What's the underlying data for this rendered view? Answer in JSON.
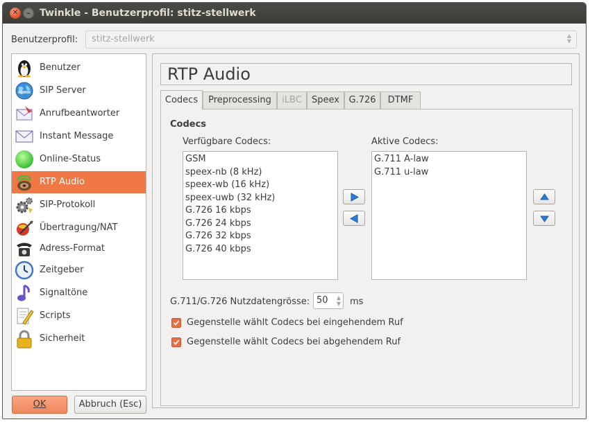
{
  "window": {
    "title": "Twinkle - Benutzerprofil: stitz-stellwerk"
  },
  "profile": {
    "label": "Benutzerprofil:",
    "value": "stitz-stellwerk"
  },
  "sidebar": {
    "items": [
      {
        "label": "Benutzer",
        "icon": "penguin-user-icon"
      },
      {
        "label": "SIP Server",
        "icon": "globe-server-icon"
      },
      {
        "label": "Anrufbeantworter",
        "icon": "voicemail-envelope-icon"
      },
      {
        "label": "Instant Message",
        "icon": "envelope-icon"
      },
      {
        "label": "Online-Status",
        "icon": "green-status-icon"
      },
      {
        "label": "RTP Audio",
        "icon": "audio-speaker-icon",
        "active": true
      },
      {
        "label": "SIP-Protokoll",
        "icon": "gear-protocol-icon"
      },
      {
        "label": "Übertragung/NAT",
        "icon": "network-transfer-icon"
      },
      {
        "label": "Adress-Format",
        "icon": "telephone-icon"
      },
      {
        "label": "Zeitgeber",
        "icon": "clock-icon"
      },
      {
        "label": "Signaltöne",
        "icon": "music-note-icon"
      },
      {
        "label": "Scripts",
        "icon": "script-pencil-icon"
      },
      {
        "label": "Sicherheit",
        "icon": "padlock-icon"
      }
    ]
  },
  "buttons": {
    "ok": "OK",
    "cancel": "Abbruch (Esc)"
  },
  "page": {
    "title": "RTP Audio"
  },
  "tabs": [
    {
      "label": "Codecs",
      "active": true
    },
    {
      "label": "Preprocessing"
    },
    {
      "label": "iLBC",
      "disabled": true
    },
    {
      "label": "Speex"
    },
    {
      "label": "G.726"
    },
    {
      "label": "DTMF"
    }
  ],
  "codecs": {
    "heading": "Codecs",
    "available_label": "Verfügbare Codecs:",
    "active_label": "Aktive Codecs:",
    "available": [
      "GSM",
      "speex-nb (8 kHz)",
      "speex-wb (16 kHz)",
      "speex-uwb (32 kHz)",
      "G.726 16 kbps",
      "G.726 24 kbps",
      "G.726 32 kbps",
      "G.726 40 kbps"
    ],
    "active": [
      "G.711 A-law",
      "G.711 u-law"
    ],
    "payload_label": "G.711/G.726 Nutzdatengrösse:",
    "payload_value": "50",
    "payload_unit": "ms",
    "incoming_label": "Gegenstelle wählt Codecs bei eingehendem Ruf",
    "incoming_checked": true,
    "outgoing_label": "Gegenstelle wählt Codecs bei abgehendem Ruf",
    "outgoing_checked": true
  },
  "colors": {
    "accent": "#f07746",
    "titlebar": "#3c3b37",
    "arrow_blue": "#2a7fd4"
  }
}
